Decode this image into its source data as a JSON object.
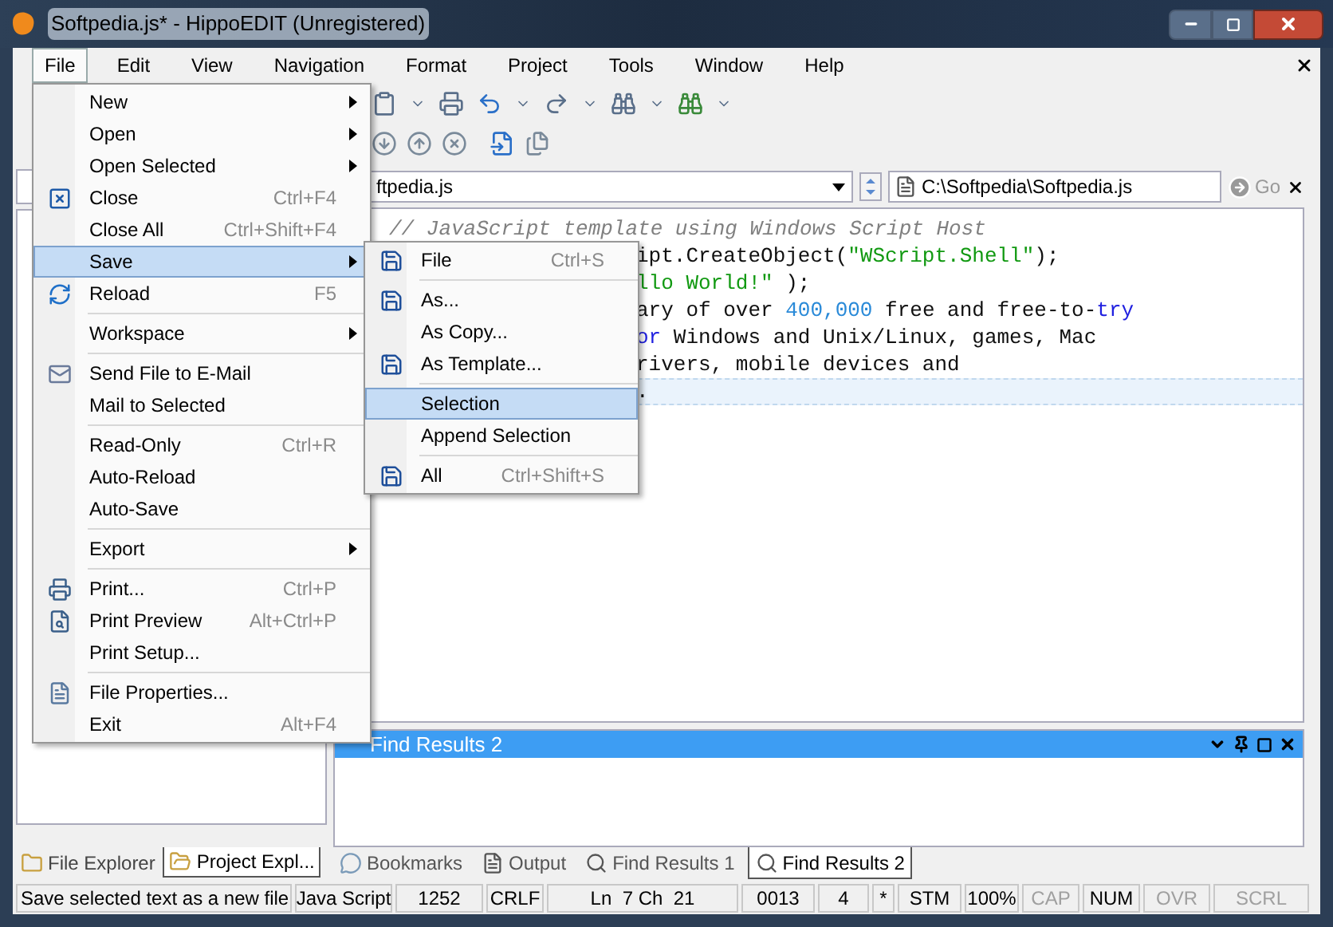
{
  "window": {
    "title": "Softpedia.js* - HippoEDIT (Unregistered)"
  },
  "menu_bar": [
    {
      "label": "File",
      "selected": true
    },
    {
      "label": "Edit",
      "selected": false
    },
    {
      "label": "View",
      "selected": false
    },
    {
      "label": "Navigation",
      "selected": false
    },
    {
      "label": "Format",
      "selected": false
    },
    {
      "label": "Project",
      "selected": false
    },
    {
      "label": "Tools",
      "selected": false
    },
    {
      "label": "Window",
      "selected": false
    },
    {
      "label": "Help",
      "selected": false
    }
  ],
  "file_menu": [
    {
      "label": "New",
      "submenu": true,
      "selected": false,
      "divider_above": false
    },
    {
      "label": "Open",
      "submenu": true,
      "selected": false,
      "divider_above": false
    },
    {
      "label": "Open Selected",
      "submenu": true,
      "selected": false,
      "divider_above": false
    },
    {
      "label": "Close",
      "shortcut": "Ctrl+F4",
      "submenu": false,
      "selected": false,
      "divider_above": false
    },
    {
      "label": "Close All",
      "shortcut": "Ctrl+Shift+F4",
      "submenu": false,
      "selected": false,
      "divider_above": false
    },
    {
      "label": "Save",
      "submenu": true,
      "selected": true,
      "divider_above": false
    },
    {
      "label": "Reload",
      "shortcut": "F5",
      "submenu": false,
      "selected": false,
      "divider_above": false
    },
    {
      "label": "Workspace",
      "submenu": true,
      "selected": false,
      "divider_above": true
    },
    {
      "label": "Send File to E-Mail",
      "submenu": false,
      "selected": false,
      "divider_above": true
    },
    {
      "label": "Mail to Selected",
      "submenu": false,
      "selected": false,
      "divider_above": false
    },
    {
      "label": "Read-Only",
      "shortcut": "Ctrl+R",
      "submenu": false,
      "selected": false,
      "divider_above": true
    },
    {
      "label": "Auto-Reload",
      "submenu": false,
      "selected": false,
      "divider_above": false
    },
    {
      "label": "Auto-Save",
      "submenu": false,
      "selected": false,
      "divider_above": false
    },
    {
      "label": "Export",
      "submenu": true,
      "selected": false,
      "divider_above": true
    },
    {
      "label": "Print...",
      "shortcut": "Ctrl+P",
      "submenu": false,
      "selected": false,
      "divider_above": true
    },
    {
      "label": "Print Preview",
      "shortcut": "Alt+Ctrl+P",
      "submenu": false,
      "selected": false,
      "divider_above": false
    },
    {
      "label": "Print Setup...",
      "submenu": false,
      "selected": false,
      "divider_above": false
    },
    {
      "label": "File Properties...",
      "submenu": false,
      "selected": false,
      "divider_above": true
    },
    {
      "label": "Exit",
      "shortcut": "Alt+F4",
      "submenu": false,
      "selected": false,
      "divider_above": false
    }
  ],
  "save_submenu": [
    {
      "label": "File",
      "shortcut": "Ctrl+S",
      "selected": false,
      "divider_above": false
    },
    {
      "label": "As...",
      "selected": false,
      "divider_above": true
    },
    {
      "label": "As Copy...",
      "selected": false,
      "divider_above": false
    },
    {
      "label": "As Template...",
      "selected": false,
      "divider_above": false
    },
    {
      "label": "Selection",
      "selected": true,
      "divider_above": true
    },
    {
      "label": "Append Selection",
      "selected": false,
      "divider_above": false
    },
    {
      "label": "All",
      "shortcut": "Ctrl+Shift+S",
      "selected": false,
      "divider_above": true
    }
  ],
  "address_bar": {
    "file_combo": "ftpedia.js",
    "path": "C:\\Softpedia\\Softpedia.js",
    "go_button": "Go"
  },
  "editor": {
    "lines": [
      {
        "clipped": false,
        "current": false,
        "segments": [
          {
            "kind": "comment",
            "text": "// JavaScript template using Windows Script Host"
          }
        ]
      },
      {
        "clipped": true,
        "current": false,
        "segments": [
          {
            "kind": "plain",
            "text": "ipt.CreateObject("
          },
          {
            "kind": "string",
            "text": "\"WScript.Shell\""
          },
          {
            "kind": "plain",
            "text": ");"
          }
        ]
      },
      {
        "clipped": true,
        "current": false,
        "segments": [
          {
            "kind": "string",
            "text": "llo World!\""
          },
          {
            "kind": "plain",
            "text": " );"
          }
        ]
      },
      {
        "clipped": true,
        "current": false,
        "segments": [
          {
            "kind": "plain",
            "text": "ary of over "
          },
          {
            "kind": "number",
            "text": "400,000"
          },
          {
            "kind": "plain",
            "text": " free and free-to-"
          },
          {
            "kind": "keyword",
            "text": "try"
          }
        ]
      },
      {
        "clipped": true,
        "current": false,
        "segments": [
          {
            "kind": "keyword",
            "text": "or"
          },
          {
            "kind": "plain",
            "text": " Windows and Unix/Linux, games, Mac"
          }
        ]
      },
      {
        "clipped": true,
        "current": false,
        "segments": [
          {
            "kind": "plain",
            "text": "rivers, mobile devices and"
          }
        ]
      },
      {
        "clipped": true,
        "current": true,
        "segments": [
          {
            "kind": "plain",
            "text": "."
          }
        ]
      }
    ]
  },
  "find_results_panel": {
    "title": "Find Results 2"
  },
  "left_panel_tabs": [
    {
      "label": "File Explorer",
      "selected": false
    },
    {
      "label": "Project Expl...",
      "selected": true
    }
  ],
  "bottom_tabs": [
    {
      "label": "Bookmarks",
      "selected": false
    },
    {
      "label": "Output",
      "selected": false
    },
    {
      "label": "Find Results 1",
      "selected": false
    },
    {
      "label": "Find Results 2",
      "selected": true
    }
  ],
  "status_bar": [
    {
      "text": "Save selected text as a new file",
      "disabled": false
    },
    {
      "text": "Java Script",
      "disabled": false
    },
    {
      "text": "1252",
      "disabled": false
    },
    {
      "text": "CRLF",
      "disabled": false
    },
    {
      "text": "Ln  7 Ch  21",
      "disabled": false
    },
    {
      "text": "0013",
      "disabled": false
    },
    {
      "text": "4",
      "disabled": false
    },
    {
      "text": "*",
      "disabled": false
    },
    {
      "text": "STM",
      "disabled": false
    },
    {
      "text": "100%",
      "disabled": false
    },
    {
      "text": "CAP",
      "disabled": true
    },
    {
      "text": "NUM",
      "disabled": false
    },
    {
      "text": "OVR",
      "disabled": true
    },
    {
      "text": "SCRL",
      "disabled": true
    }
  ]
}
